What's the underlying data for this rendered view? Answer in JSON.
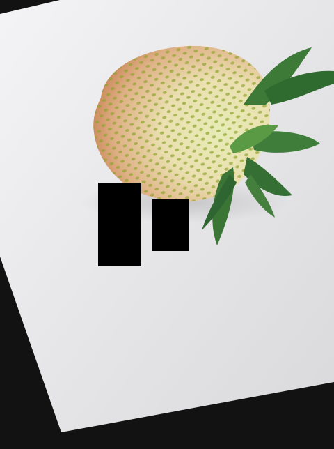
{
  "image": {
    "subject": "unripe-strawberry",
    "background": "white-sheet-rotated",
    "colors": {
      "outer": "#121212",
      "sheet": "#e9e9ea",
      "berry_base": "#e9e2b2",
      "berry_blush": "#d48c5c",
      "seeds": "#8aa02a",
      "calyx": "#3c7a3a",
      "redaction": "#000000"
    },
    "redaction_boxes": 2
  }
}
